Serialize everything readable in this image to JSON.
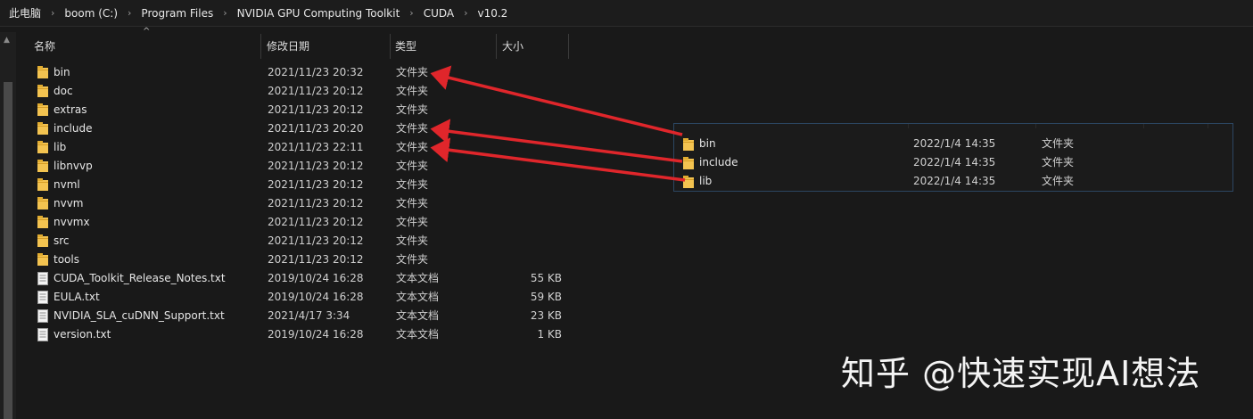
{
  "breadcrumb": [
    "此电脑",
    "boom (C:)",
    "Program Files",
    "NVIDIA GPU Computing Toolkit",
    "CUDA",
    "v10.2"
  ],
  "breadcrumb_separator": "›",
  "columns": {
    "name": "名称",
    "date": "修改日期",
    "type": "类型",
    "size": "大小"
  },
  "main_files": [
    {
      "name": "bin",
      "date": "2021/11/23 20:32",
      "type": "文件夹",
      "size": "",
      "icon": "folder-icon"
    },
    {
      "name": "doc",
      "date": "2021/11/23 20:12",
      "type": "文件夹",
      "size": "",
      "icon": "folder-icon"
    },
    {
      "name": "extras",
      "date": "2021/11/23 20:12",
      "type": "文件夹",
      "size": "",
      "icon": "folder-icon"
    },
    {
      "name": "include",
      "date": "2021/11/23 20:20",
      "type": "文件夹",
      "size": "",
      "icon": "folder-icon"
    },
    {
      "name": "lib",
      "date": "2021/11/23 22:11",
      "type": "文件夹",
      "size": "",
      "icon": "folder-icon"
    },
    {
      "name": "libnvvp",
      "date": "2021/11/23 20:12",
      "type": "文件夹",
      "size": "",
      "icon": "folder-icon"
    },
    {
      "name": "nvml",
      "date": "2021/11/23 20:12",
      "type": "文件夹",
      "size": "",
      "icon": "folder-icon"
    },
    {
      "name": "nvvm",
      "date": "2021/11/23 20:12",
      "type": "文件夹",
      "size": "",
      "icon": "folder-icon"
    },
    {
      "name": "nvvmx",
      "date": "2021/11/23 20:12",
      "type": "文件夹",
      "size": "",
      "icon": "folder-icon"
    },
    {
      "name": "src",
      "date": "2021/11/23 20:12",
      "type": "文件夹",
      "size": "",
      "icon": "folder-icon"
    },
    {
      "name": "tools",
      "date": "2021/11/23 20:12",
      "type": "文件夹",
      "size": "",
      "icon": "folder-icon"
    },
    {
      "name": "CUDA_Toolkit_Release_Notes.txt",
      "date": "2019/10/24 16:28",
      "type": "文本文档",
      "size": "55 KB",
      "icon": "text-file-icon"
    },
    {
      "name": "EULA.txt",
      "date": "2019/10/24 16:28",
      "type": "文本文档",
      "size": "59 KB",
      "icon": "text-file-icon"
    },
    {
      "name": "NVIDIA_SLA_cuDNN_Support.txt",
      "date": "2021/4/17 3:34",
      "type": "文本文档",
      "size": "23 KB",
      "icon": "text-file-icon"
    },
    {
      "name": "version.txt",
      "date": "2019/10/24 16:28",
      "type": "文本文档",
      "size": "1 KB",
      "icon": "text-file-icon"
    }
  ],
  "inset_files": [
    {
      "name": "bin",
      "date": "2022/1/4 14:35",
      "type": "文件夹",
      "icon": "folder-icon"
    },
    {
      "name": "include",
      "date": "2022/1/4 14:35",
      "type": "文件夹",
      "icon": "folder-icon"
    },
    {
      "name": "lib",
      "date": "2022/1/4 14:35",
      "type": "文件夹",
      "icon": "folder-icon"
    }
  ],
  "watermark": "知乎 @快速实现AI想法",
  "colors": {
    "background": "#191919",
    "folder": "#f3c350",
    "arrow": "#e0262b",
    "inset_border": "#2c4662"
  }
}
